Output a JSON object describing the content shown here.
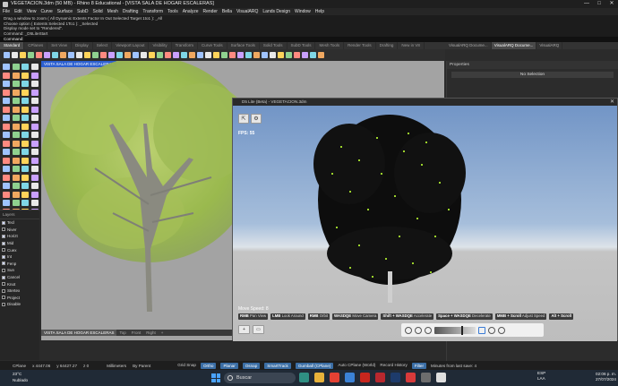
{
  "window": {
    "title": "VEGETACION.3dm (50 MB) - Rhino 8 Educational - [VISTA SALA DE HOGAR ESCALERAS]"
  },
  "menu": [
    "File",
    "Edit",
    "View",
    "Curve",
    "Surface",
    "SubD",
    "Solid",
    "Mesh",
    "Drafting",
    "Transform",
    "Tools",
    "Analyze",
    "Render",
    "Bella",
    "VisualARQ",
    "Lands Design",
    "Window",
    "Help"
  ],
  "command_history": [
    "Drag a window to zoom ( All  Dynamic  Extents  Factor  In  Out  Selected  Target  1to1 ): _All",
    "Choose option ( Extents  Selected  1To1 ): _Selected",
    "Display mode set to \"Rendered\".",
    "Command: _D5LiteStart"
  ],
  "command_prompt": "Command:",
  "toolbar_tabs": [
    "Standard",
    "CPlanes",
    "Set View",
    "Display",
    "Select",
    "Viewport Layout",
    "Visibility",
    "Transform",
    "Curve Tools",
    "Surface Tools",
    "Solid Tools",
    "SubD Tools",
    "Mesh Tools",
    "Render Tools",
    "Drafting",
    "New in V8"
  ],
  "panel_tabs": [
    "VisualARQ Docume...",
    "VisualARQ Docume...",
    "VisualARQ"
  ],
  "properties": {
    "header": "Properties",
    "selection": "No Selection"
  },
  "layers": {
    "header": "Layers",
    "items": [
      {
        "name": "Tecl",
        "on": true
      },
      {
        "name": "Niver",
        "on": false
      },
      {
        "name": "Horizt",
        "on": true
      },
      {
        "name": "Mid",
        "on": true
      },
      {
        "name": "Cuex",
        "on": false
      },
      {
        "name": "Int",
        "on": true
      },
      {
        "name": "Fenp",
        "on": true
      },
      {
        "name": "Sun",
        "on": false
      },
      {
        "name": "Cancel",
        "on": true
      },
      {
        "name": "Knot",
        "on": false
      },
      {
        "name": "Stertex",
        "on": false
      },
      {
        "name": "Project",
        "on": false
      },
      {
        "name": "Disable",
        "on": false
      }
    ]
  },
  "viewport": {
    "label": "VISTA SALA DE HOGAR ESCALERAS",
    "tabs": [
      "VISTA SALA DE HOGAR ESCALERAS",
      "Top",
      "Front",
      "Right",
      "+"
    ]
  },
  "d5": {
    "title": "D5 Lite (Beta) - VEGETACION.3dm",
    "fps": "FPS: 55",
    "move_speed": "Move Speed: 8",
    "hints": [
      {
        "key": "RMB",
        "action": "Pan View"
      },
      {
        "key": "LMB",
        "action": "Look Around"
      },
      {
        "key": "RMB",
        "action": "Orbit"
      },
      {
        "key": "WASDQE",
        "action": "Move Camera"
      },
      {
        "key": "Shift + WASDQE",
        "action": "Accelerate"
      },
      {
        "key": "Space + WASDQE",
        "action": "Decelerate"
      },
      {
        "key": "MMB + Scroll",
        "action": "Adjust Speed"
      },
      {
        "key": "Alt + Scroll",
        "action": ""
      }
    ]
  },
  "status": {
    "cplane": "CPlane",
    "x": "x 4447.06",
    "y": "y 64427.27",
    "z": "z 0",
    "units": "Millimeters",
    "layer": "By Parent",
    "toggles": [
      "Grid Snap",
      "Ortho",
      "Planar",
      "Osnap",
      "SmartTrack",
      "Gumball (CPlane)",
      "Auto CPlane (World)",
      "Record History",
      "Filter"
    ],
    "save": "Minutes from last save: 4"
  },
  "taskbar": {
    "weather_temp": "23°C",
    "weather_desc": "Nublado",
    "search": "Buscar",
    "lang": "ESP",
    "lang2": "LAA",
    "time": "02:06 p. m.",
    "date": "27/07/2024"
  }
}
